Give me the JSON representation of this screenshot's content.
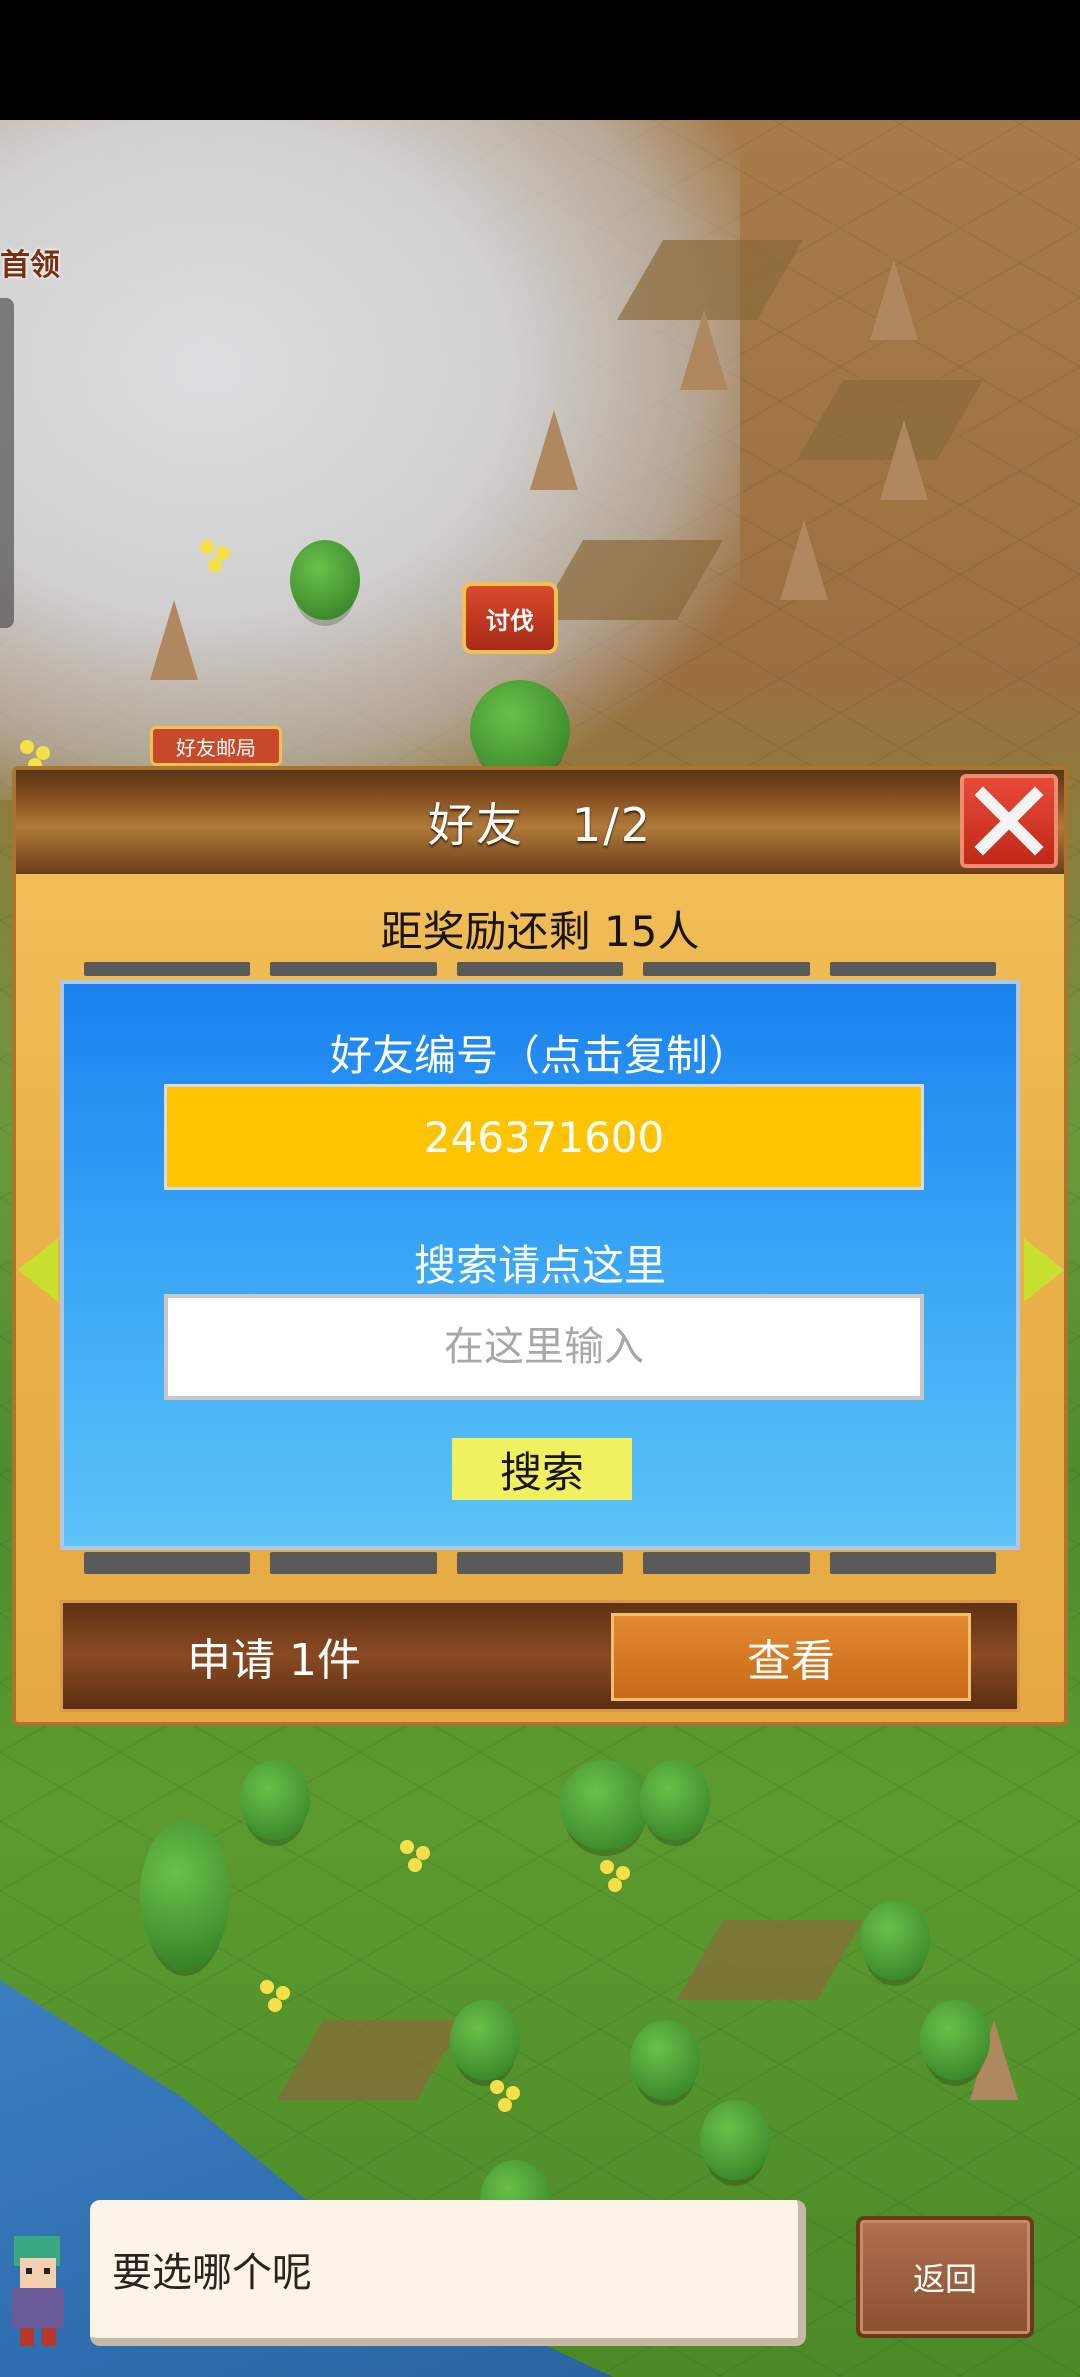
{
  "map": {
    "boss_label": "首领",
    "subjugate_marker": "讨伐",
    "friend_post_sign": "好友邮局"
  },
  "friend_panel": {
    "title": "好友　1/2",
    "reward_remaining": "距奖励还剩 15人",
    "friend_id_label": "好友编号（点击复制）",
    "friend_id_value": "246371600",
    "search_label": "搜索请点这里",
    "search_placeholder": "在这里输入",
    "search_button": "搜索",
    "request_count_text": "申请 1件",
    "view_button": "查看"
  },
  "dialog": {
    "message": "要选哪个呢",
    "back_button": "返回"
  },
  "colors": {
    "panel_bg": "#eab24a",
    "header_brown": "#8a5424",
    "blue_box": "#3aa6f6",
    "id_box": "#ffc400",
    "search_button": "#f0f060",
    "close_red": "#d83828",
    "view_orange": "#d87a24",
    "nav_arrow": "#c8e030"
  }
}
